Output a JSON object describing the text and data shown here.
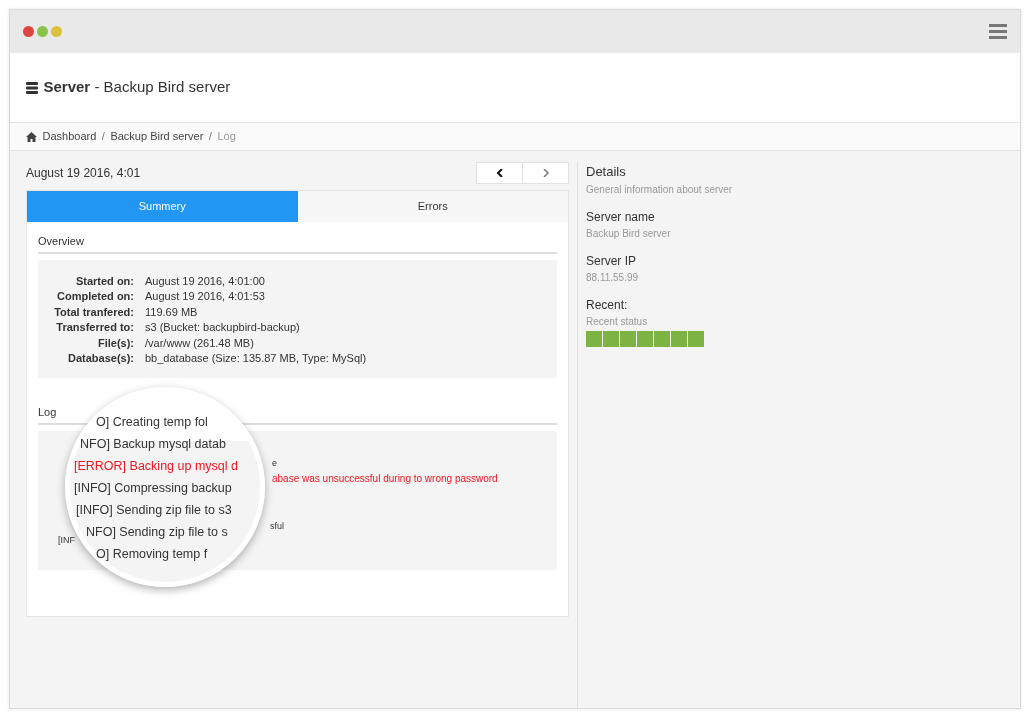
{
  "window": {
    "controls": [
      {
        "color": "#e0443e"
      },
      {
        "color": "#8bc34a"
      },
      {
        "color": "#dcc13f"
      }
    ]
  },
  "header": {
    "title_bold": "Server",
    "title_rest": "- Backup Bird server"
  },
  "breadcrumb": [
    {
      "label": "Dashboard",
      "active": false
    },
    {
      "separator": "/",
      "label": "Backup Bird server",
      "active": false
    },
    {
      "separator": "/",
      "label": "Log",
      "active": true
    }
  ],
  "date": "August 19 2016, 4:01",
  "tabs": [
    {
      "label": "Summery",
      "selected": true
    },
    {
      "label": "Errors",
      "selected": false
    }
  ],
  "overview": {
    "title": "Overview",
    "rows": [
      {
        "label": "Started on:",
        "value": "August 19 2016, 4:01:00"
      },
      {
        "label": "Completed on:",
        "value": "August 19 2016, 4:01:53"
      },
      {
        "label": "Total tranfered:",
        "value": "119.69 MB"
      },
      {
        "label": "Transferred to:",
        "value": "s3 (Bucket: backupbird-backup)"
      },
      {
        "label": "File(s):",
        "value": "/var/www (261.48 MB)"
      },
      {
        "label": "Database(s):",
        "value": "bb_database (Size: 135.87 MB, Type: MySql)"
      }
    ]
  },
  "log": {
    "title": "Log",
    "lines": [
      {
        "text": "e",
        "kind": "info"
      },
      {
        "text": "abase was unsuccessful during to wrong password",
        "kind": "error"
      },
      {
        "text": "sful",
        "kind": "info"
      },
      {
        "text": "[INF",
        "kind": "info"
      }
    ],
    "magnified": [
      {
        "text": "O] Creating temp fol",
        "kind": "info"
      },
      {
        "text": "NFO] Backup mysql datab",
        "kind": "info"
      },
      {
        "text": "[ERROR] Backing up mysql d",
        "kind": "error"
      },
      {
        "text": "[INFO] Compressing backup",
        "kind": "info"
      },
      {
        "text": "[INFO] Sending zip file to s3",
        "kind": "info"
      },
      {
        "text": "NFO] Sending zip file to s",
        "kind": "info"
      },
      {
        "text": "O] Removing temp f",
        "kind": "info"
      }
    ]
  },
  "details": {
    "title": "Details",
    "subtitle": "General information about server",
    "fields": [
      {
        "label": "Server name",
        "value": "Backup Bird server"
      },
      {
        "label": "Server IP",
        "value": "88.11.55.99"
      },
      {
        "label": "Recent:",
        "value": "Recent status"
      }
    ],
    "recent": [
      {
        "color": "#7cb342"
      },
      {
        "color": "#7cb342"
      },
      {
        "color": "#7cb342"
      },
      {
        "color": "#7cb342"
      },
      {
        "color": "#7cb342"
      },
      {
        "color": "#7cb342"
      },
      {
        "color": "#7cb342"
      }
    ]
  }
}
